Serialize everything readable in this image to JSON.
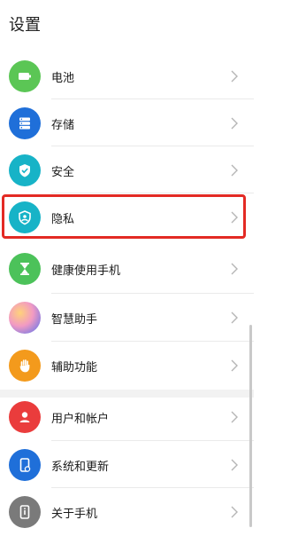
{
  "header": {
    "title": "设置"
  },
  "groups": [
    {
      "items": [
        {
          "label": "电池",
          "icon": "battery-icon",
          "color": "#5bc655"
        },
        {
          "label": "存储",
          "icon": "storage-icon",
          "color": "#1f6fd9"
        },
        {
          "label": "安全",
          "icon": "shield-check-icon",
          "color": "#17b3c7"
        },
        {
          "label": "隐私",
          "icon": "privacy-shield-icon",
          "color": "#17b3c7"
        },
        {
          "label": "健康使用手机",
          "icon": "hourglass-icon",
          "color": "#4cc25a"
        },
        {
          "label": "智慧助手",
          "icon": "assistant-icon",
          "color": "#e58ac5"
        },
        {
          "label": "辅助功能",
          "icon": "hand-icon",
          "color": "#f39a1c"
        }
      ]
    },
    {
      "items": [
        {
          "label": "用户和帐户",
          "icon": "user-icon",
          "color": "#ea3c3c"
        },
        {
          "label": "系统和更新",
          "icon": "phone-update-icon",
          "color": "#1f6fd9"
        },
        {
          "label": "关于手机",
          "icon": "phone-info-icon",
          "color": "#7a7a7a"
        }
      ]
    }
  ],
  "highlight_color": "#e32a24"
}
